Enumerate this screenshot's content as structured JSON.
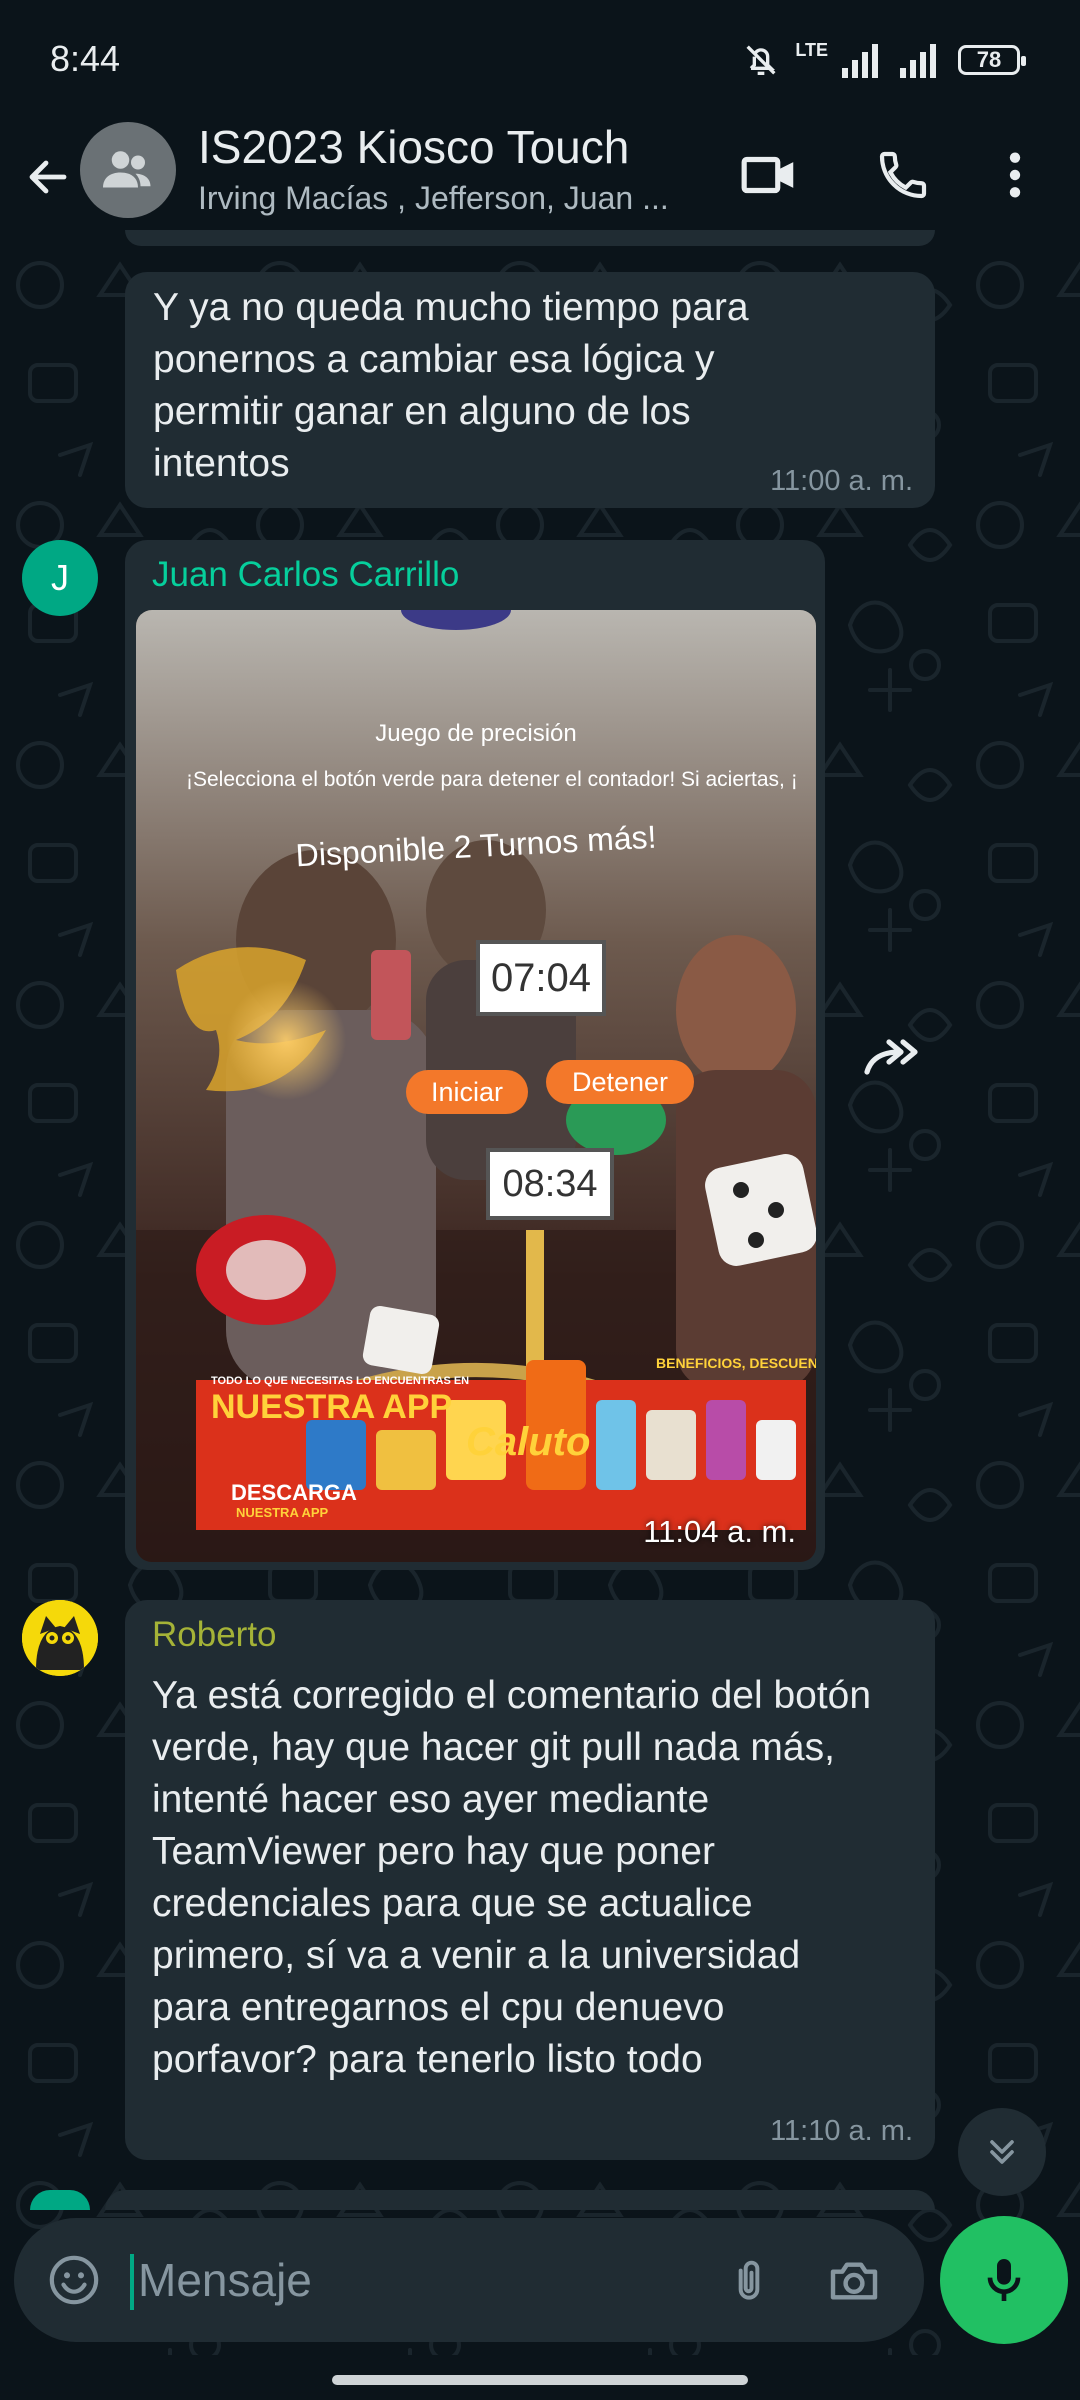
{
  "status_bar": {
    "time": "8:44",
    "network": "LTE",
    "battery": "78"
  },
  "header": {
    "title": "IS2023 Kiosco Touch",
    "subtitle": "Irving Macías , Jefferson, Juan ...",
    "icons": [
      "back-arrow-icon",
      "group-icon",
      "video-call-icon",
      "phone-icon",
      "more-options-icon"
    ]
  },
  "messages": [
    {
      "text": "Y ya no queda mucho tiempo para ponernos a cambiar esa lógica y permitir ganar en alguno de los intentos",
      "time": "11:00 a. m."
    },
    {
      "sender": "Juan Carlos Carrillo",
      "avatar_letter": "J",
      "type": "image",
      "image": {
        "game_title": "Juego de precisión",
        "instructions": "¡Selecciona el botón verde para detener el contador! Si aciertas, ¡",
        "turns": "Disponible 2 Turnos más!",
        "counter_top": "07:04",
        "start_label": "Iniciar",
        "stop_label": "Detener",
        "counter_bottom": "08:34",
        "ad_small": "TODO LO QUE NECESITAS LO ENCUENTRAS EN",
        "ad_app": "NUESTRA APP",
        "ad_benefits": "BENEFICIOS, DESCUENTOS",
        "ad_brand": "Caluto",
        "ad_download": "DESCARGA",
        "ad_download2": "NUESTRA APP"
      },
      "time": "11:04 a. m."
    },
    {
      "sender": "Roberto",
      "text": "Ya está corregido el comentario del botón verde, hay que hacer git pull nada más, intenté hacer eso ayer mediante TeamViewer pero hay que poner credenciales para que se actualice primero, sí va a venir a la universidad para entregarnos el cpu denuevo porfavor? para tenerlo listo todo",
      "time": "11:10 a. m."
    }
  ],
  "composer": {
    "placeholder": "Mensaje"
  },
  "colors": {
    "background": "#0b141a",
    "bubble": "#202c33",
    "accent": "#00a884",
    "sender_juan": "#06cf9c",
    "sender_roberto": "#a5b337",
    "mic_button": "#21c063"
  }
}
